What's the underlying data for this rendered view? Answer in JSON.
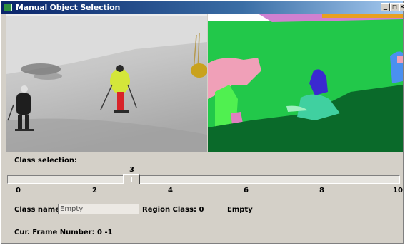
{
  "window": {
    "title": "Manual Object Selection",
    "min_glyph": "_",
    "max_glyph": "□",
    "close_glyph": "×"
  },
  "class_selection": {
    "label": "Class selection:",
    "slider_value": "3",
    "slider_min": 0,
    "slider_max": 10,
    "tick_labels": [
      "0",
      "2",
      "4",
      "6",
      "8",
      "10"
    ]
  },
  "class_name": {
    "label": "Class name:",
    "value": "Empty"
  },
  "region_class": {
    "label": "Region Class: 0",
    "value": "Empty"
  },
  "frame": {
    "label": "Cur. Frame Number: 0 -1"
  },
  "colors": {
    "window_bg": "#d4d0c8",
    "title_start": "#0a246a",
    "segment_green": "#22c84a",
    "segment_dark": "#0a5c24",
    "segment_pink": "#f0a0b8",
    "segment_blue": "#3a2ad0"
  }
}
